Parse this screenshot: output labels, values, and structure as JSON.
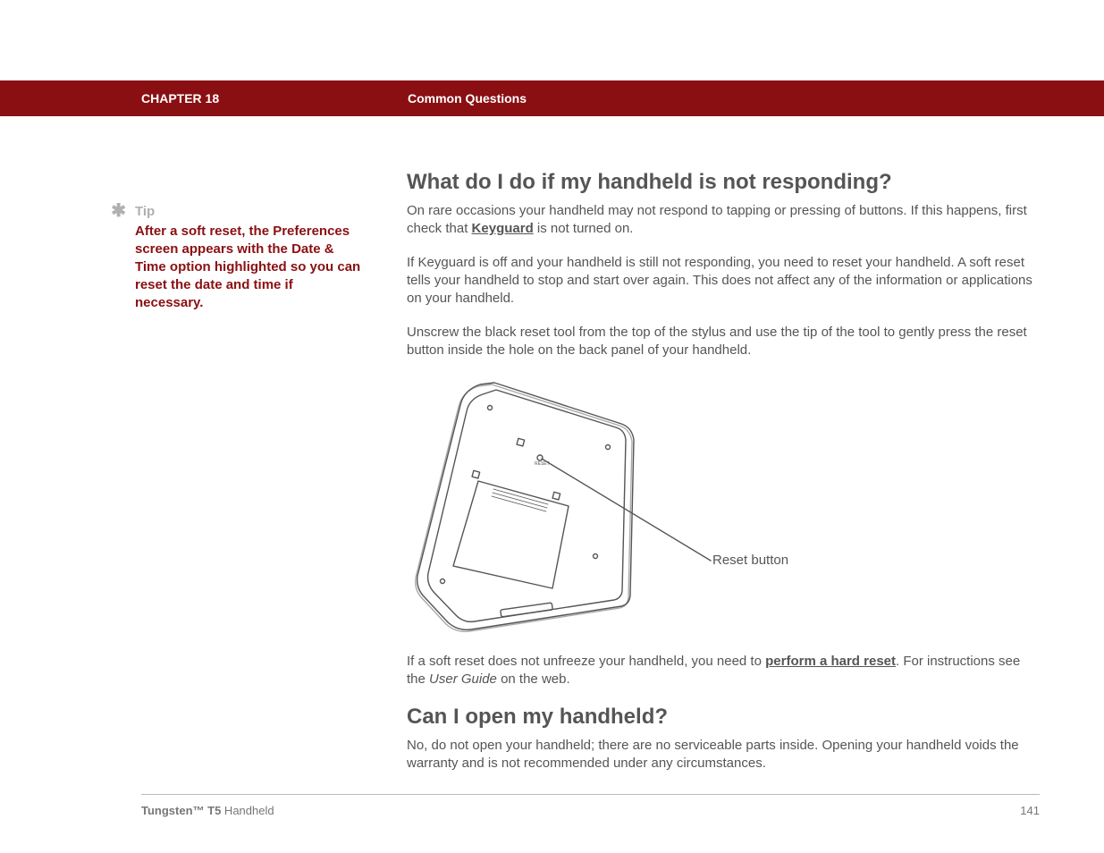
{
  "header": {
    "chapter": "CHAPTER 18",
    "section": "Common Questions"
  },
  "sidebar": {
    "tip_label": "Tip",
    "tip_body": "After a soft reset, the Preferences screen appears with the Date & Time option highlighted so you can reset the date and time if necessary."
  },
  "main": {
    "h1": "What do I do if my handheld is not responding?",
    "p1a": "On rare occasions your handheld may not respond to tapping or pressing of buttons. If this happens, first check that ",
    "p1_link": "Keyguard",
    "p1b": " is not turned on.",
    "p2": "If Keyguard is off and your handheld is still not responding, you need to reset your handheld. A soft reset tells your handheld to stop and start over again. This does not affect any of the information or applications on your handheld.",
    "p3": "Unscrew the black reset tool from the top of the stylus and use the tip of the tool to gently press the reset button inside the hole on the back panel of your handheld.",
    "figure_label": "Reset button",
    "p4a": "If a soft reset does not unfreeze your handheld, you need to ",
    "p4_link": "perform a hard reset",
    "p4b": ". For instructions see the ",
    "p4_italic": "User Guide",
    "p4c": " on the web.",
    "h2": "Can I open my handheld?",
    "p5": "No, do not open your handheld; there are no serviceable parts inside. Opening your handheld voids the warranty and is not recommended under any circumstances."
  },
  "footer": {
    "product_bold": "Tungsten™ T5",
    "product_rest": " Handheld",
    "page": "141"
  }
}
